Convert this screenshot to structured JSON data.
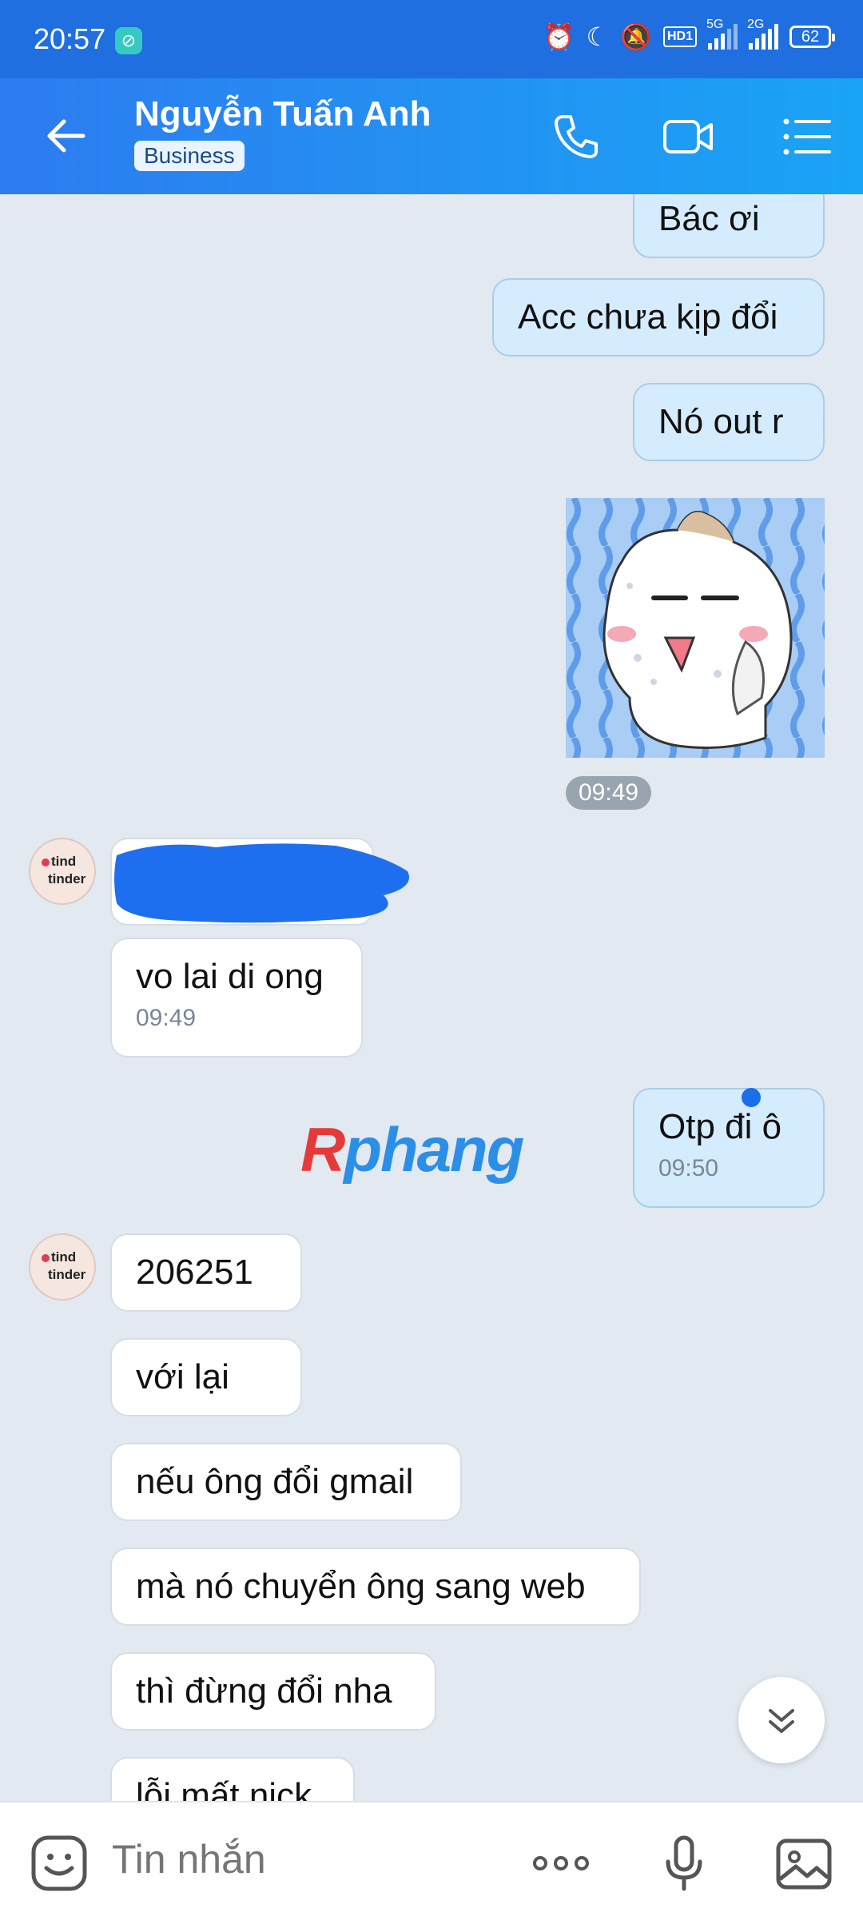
{
  "status_bar": {
    "time": "20:57",
    "net_5g": "5G",
    "net_2g": "2G",
    "hd": "HD1",
    "battery": "62"
  },
  "header": {
    "contact_name": "Nguyễn Tuấn Anh",
    "badge": "Business"
  },
  "messages": [
    {
      "dir": "out",
      "text": "Bác ơi"
    },
    {
      "dir": "out",
      "text": "Acc chưa kịp đổi"
    },
    {
      "dir": "out",
      "text": "Nó out r"
    },
    {
      "dir": "out",
      "type": "sticker",
      "time": "09:49"
    },
    {
      "dir": "in",
      "type": "redacted"
    },
    {
      "dir": "in",
      "text": "vo lai di ong",
      "time": "09:49"
    },
    {
      "dir": "out",
      "text": "Otp đi ô",
      "time": "09:50"
    },
    {
      "dir": "in",
      "text": "206251"
    },
    {
      "dir": "in",
      "text": "với lại"
    },
    {
      "dir": "in",
      "text": "nếu ông đổi gmail"
    },
    {
      "dir": "in",
      "text": "mà nó chuyển ông sang web"
    },
    {
      "dir": "in",
      "text": "thì đừng đổi nha"
    },
    {
      "dir": "in",
      "text": "lỗi mất nick"
    }
  ],
  "avatar_text": {
    "line1": "tind",
    "line2": "tinder"
  },
  "watermark": {
    "first": "R",
    "rest": "phang"
  },
  "composer": {
    "placeholder": "Tin nhắn"
  },
  "colors": {
    "header_start": "#2d7cf0",
    "header_end": "#1aa4f5",
    "outgoing_bubble": "#d5ecfe",
    "chat_bg": "#e2e9f1"
  }
}
